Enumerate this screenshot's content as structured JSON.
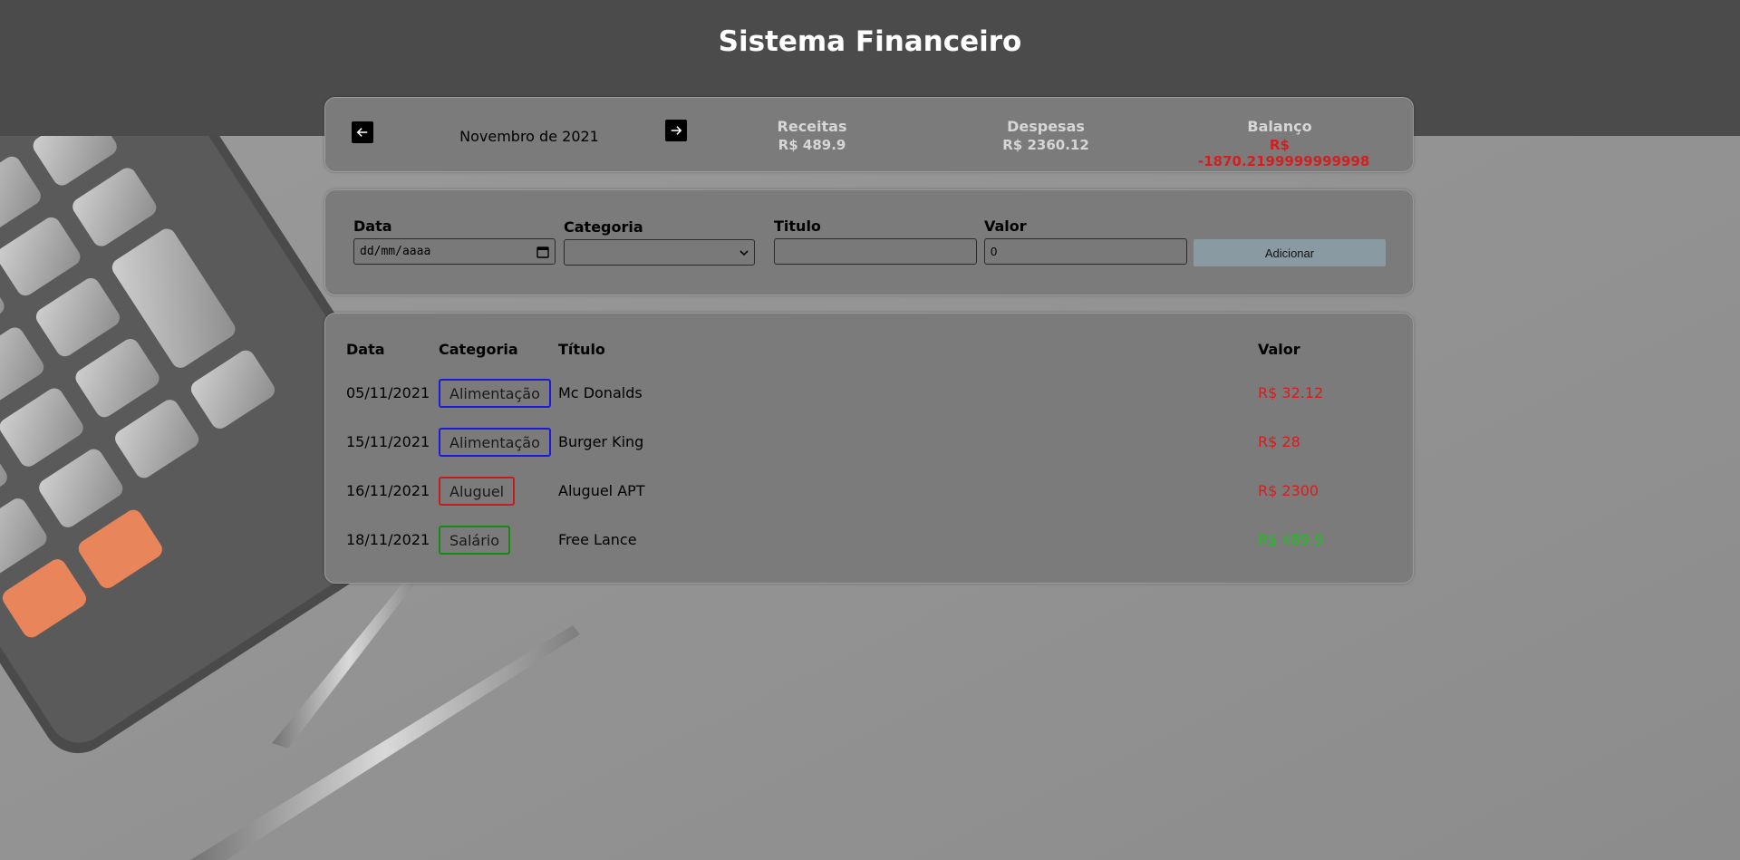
{
  "header": {
    "title": "Sistema Financeiro"
  },
  "info": {
    "month": "Novembro de 2021",
    "receitas": {
      "label": "Receitas",
      "value": "R$ 489.9"
    },
    "despesas": {
      "label": "Despesas",
      "value": "R$ 2360.12"
    },
    "balanco": {
      "label": "Balanço",
      "value": "R$ -1870.2199999999998",
      "color": "#d31f1f"
    }
  },
  "form": {
    "date": {
      "label": "Data",
      "placeholder": "dd/mm/aaaa"
    },
    "category": {
      "label": "Categoria",
      "value": ""
    },
    "title": {
      "label": "Titulo",
      "value": ""
    },
    "amount": {
      "label": "Valor",
      "value": "0"
    },
    "submit_label": "Adicionar"
  },
  "table": {
    "headers": {
      "date": "Data",
      "category": "Categoria",
      "title": "Título",
      "value": "Valor"
    },
    "rows": [
      {
        "date": "05/11/2021",
        "category": "Alimentação",
        "category_color": "#1a1adb",
        "title": "Mc Donalds",
        "value": "R$ 32.12",
        "value_color": "#d31f1f"
      },
      {
        "date": "15/11/2021",
        "category": "Alimentação",
        "category_color": "#1a1adb",
        "title": "Burger King",
        "value": "R$ 28",
        "value_color": "#d31f1f"
      },
      {
        "date": "16/11/2021",
        "category": "Aluguel",
        "category_color": "#c21e1e",
        "title": "Aluguel APT",
        "value": "R$ 2300",
        "value_color": "#d31f1f"
      },
      {
        "date": "18/11/2021",
        "category": "Salário",
        "category_color": "#158a15",
        "title": "Free Lance",
        "value": "R$ 489.9",
        "value_color": "#1fbf1f"
      }
    ]
  }
}
